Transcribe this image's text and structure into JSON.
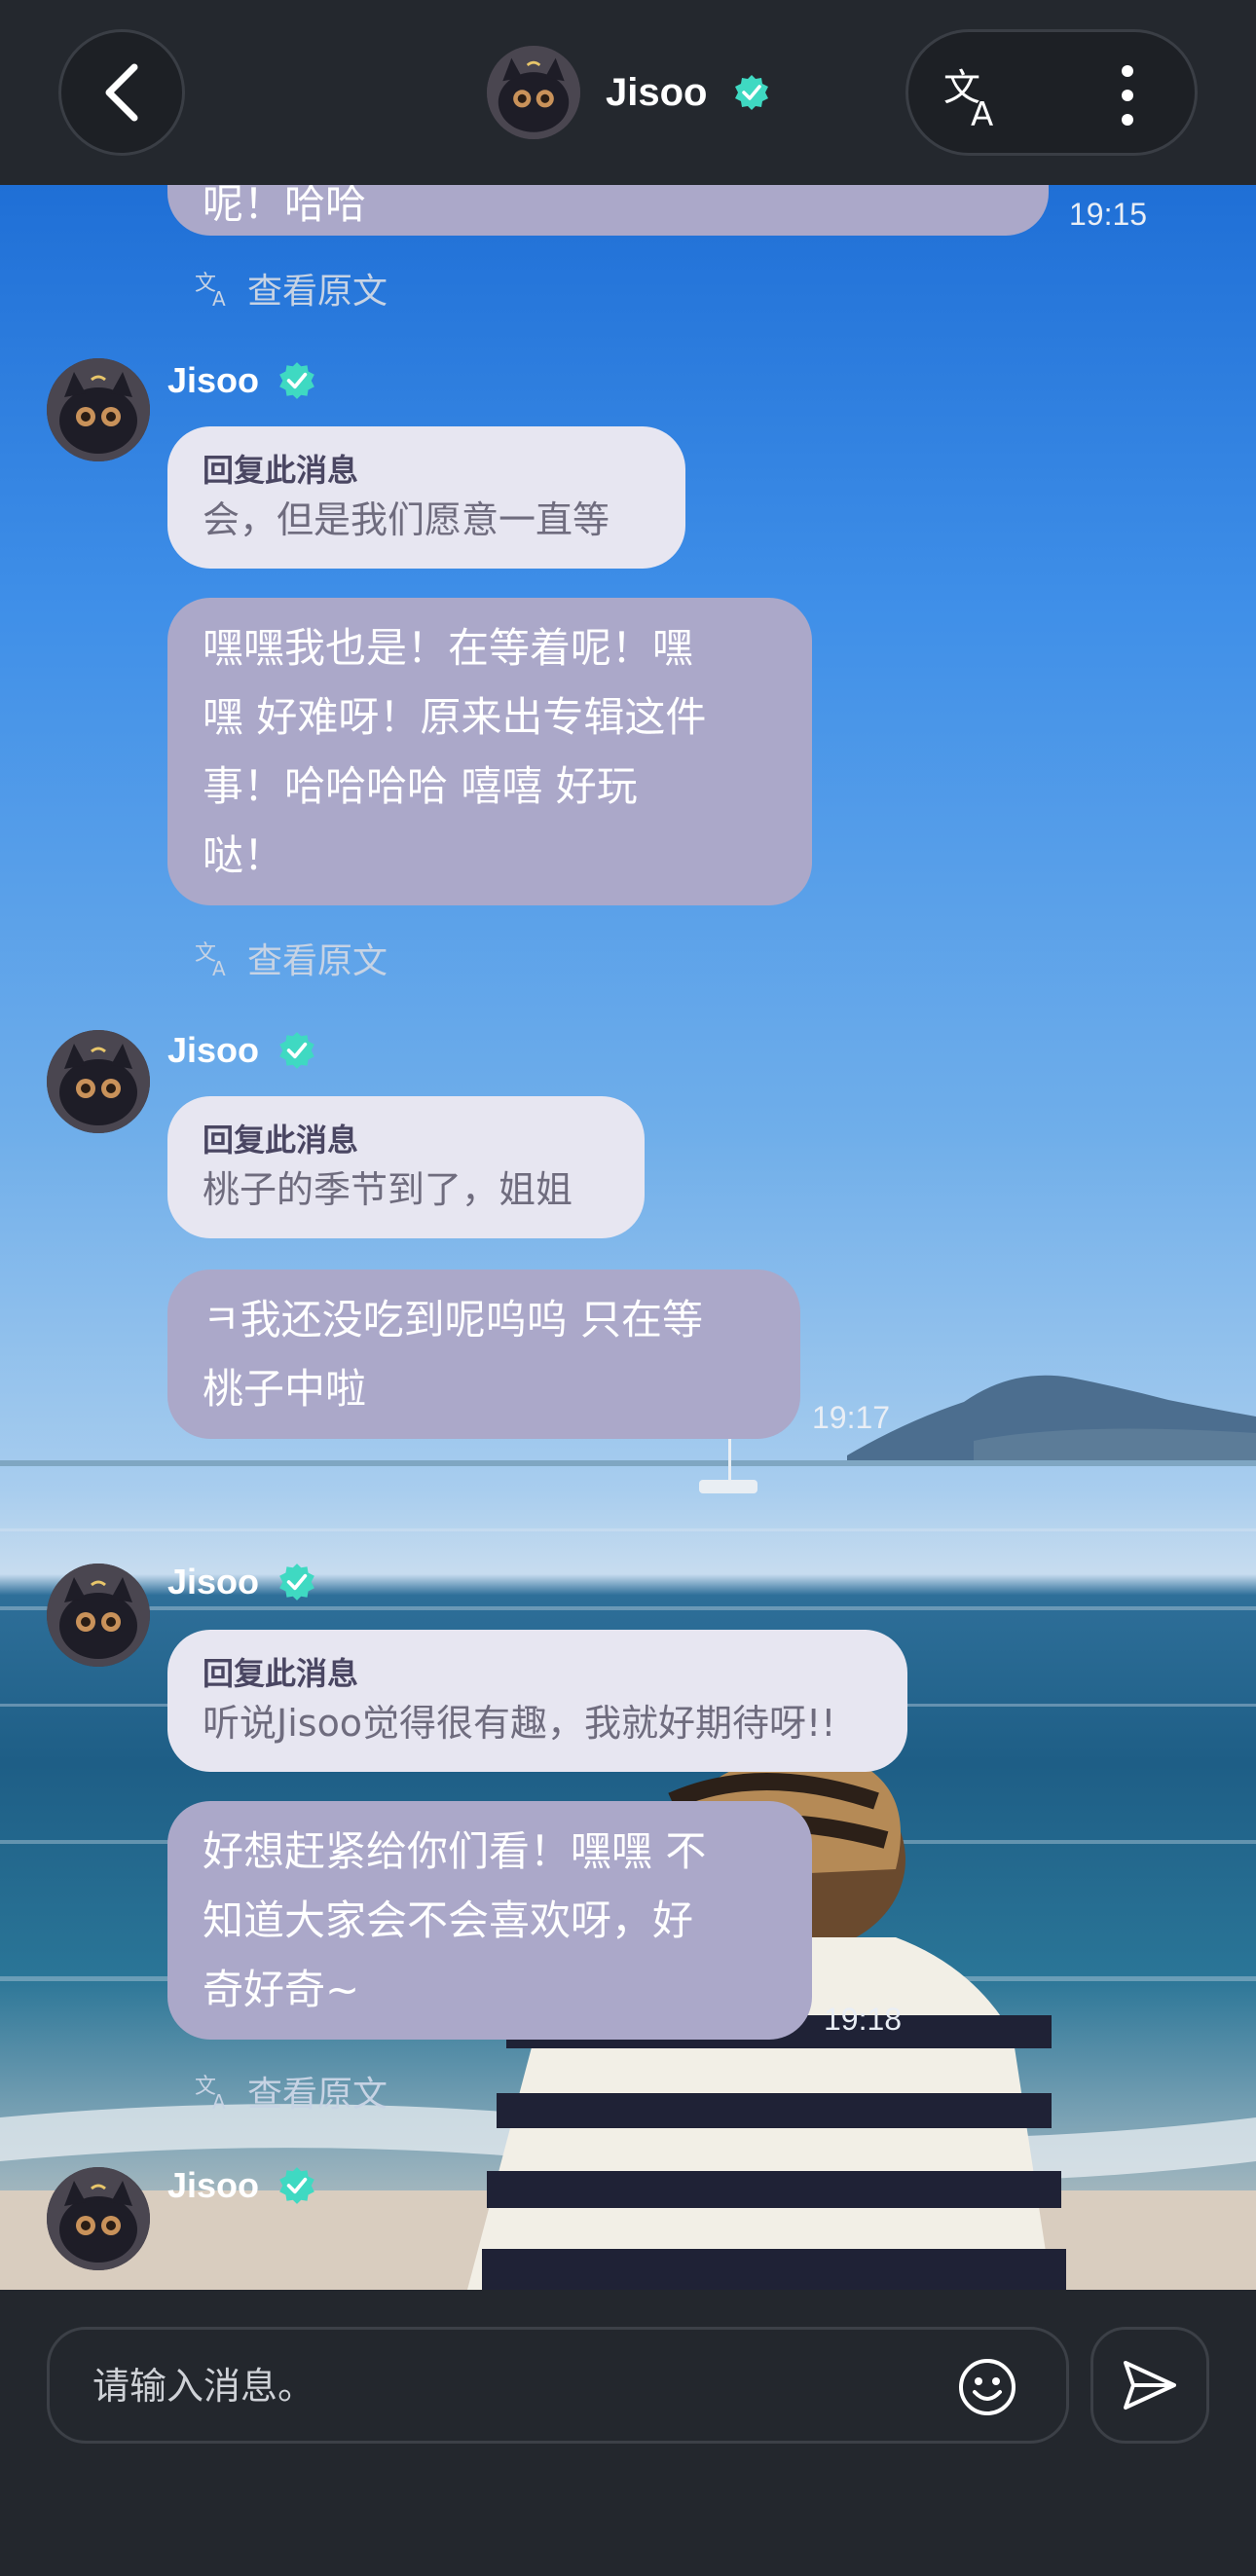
{
  "header": {
    "title": "Jisoo",
    "back_icon": "chevron-left-icon",
    "translate_icon": "translate-icon",
    "more_icon": "more-vertical-icon",
    "verified_color": "#3fd9c2"
  },
  "messages": [
    {
      "fragment_text": "呢！哈哈",
      "time": "19:15",
      "view_original": "查看原文"
    },
    {
      "sender": "Jisoo",
      "reply_title": "回复此消息",
      "reply_text": "会，但是我们愿意一直等",
      "lines": [
        "嘿嘿我也是！在等着呢！嘿",
        "嘿 好难呀！原来出专辑这件",
        "事！哈哈哈哈 嘻嘻 好玩",
        "哒！"
      ],
      "view_original": "查看原文"
    },
    {
      "sender": "Jisoo",
      "reply_title": "回复此消息",
      "reply_text": "桃子的季节到了，姐姐",
      "lines": [
        "ㅋ我还没吃到呢呜呜 只在等",
        "桃子中啦"
      ],
      "time": "19:17"
    },
    {
      "sender": "Jisoo",
      "reply_title": "回复此消息",
      "reply_text": "听说Jisoo觉得很有趣，我就好期待呀!!",
      "lines": [
        "好想赶紧给你们看！嘿嘿 不",
        "知道大家会不会喜欢呀，好",
        "奇好奇~"
      ],
      "time": "19:18",
      "view_original": "查看原文"
    },
    {
      "sender": "Jisoo"
    }
  ],
  "input": {
    "placeholder": "请输入消息。",
    "emoji_icon": "smiley-icon",
    "send_icon": "send-icon"
  },
  "scroll_down_icon": "chevron-down-icon",
  "colors": {
    "bubble": "#aba8c9",
    "reply_bubble": "#e7e6f1",
    "bar": "#23272d",
    "scroll_chevron": "#6f73ff"
  }
}
